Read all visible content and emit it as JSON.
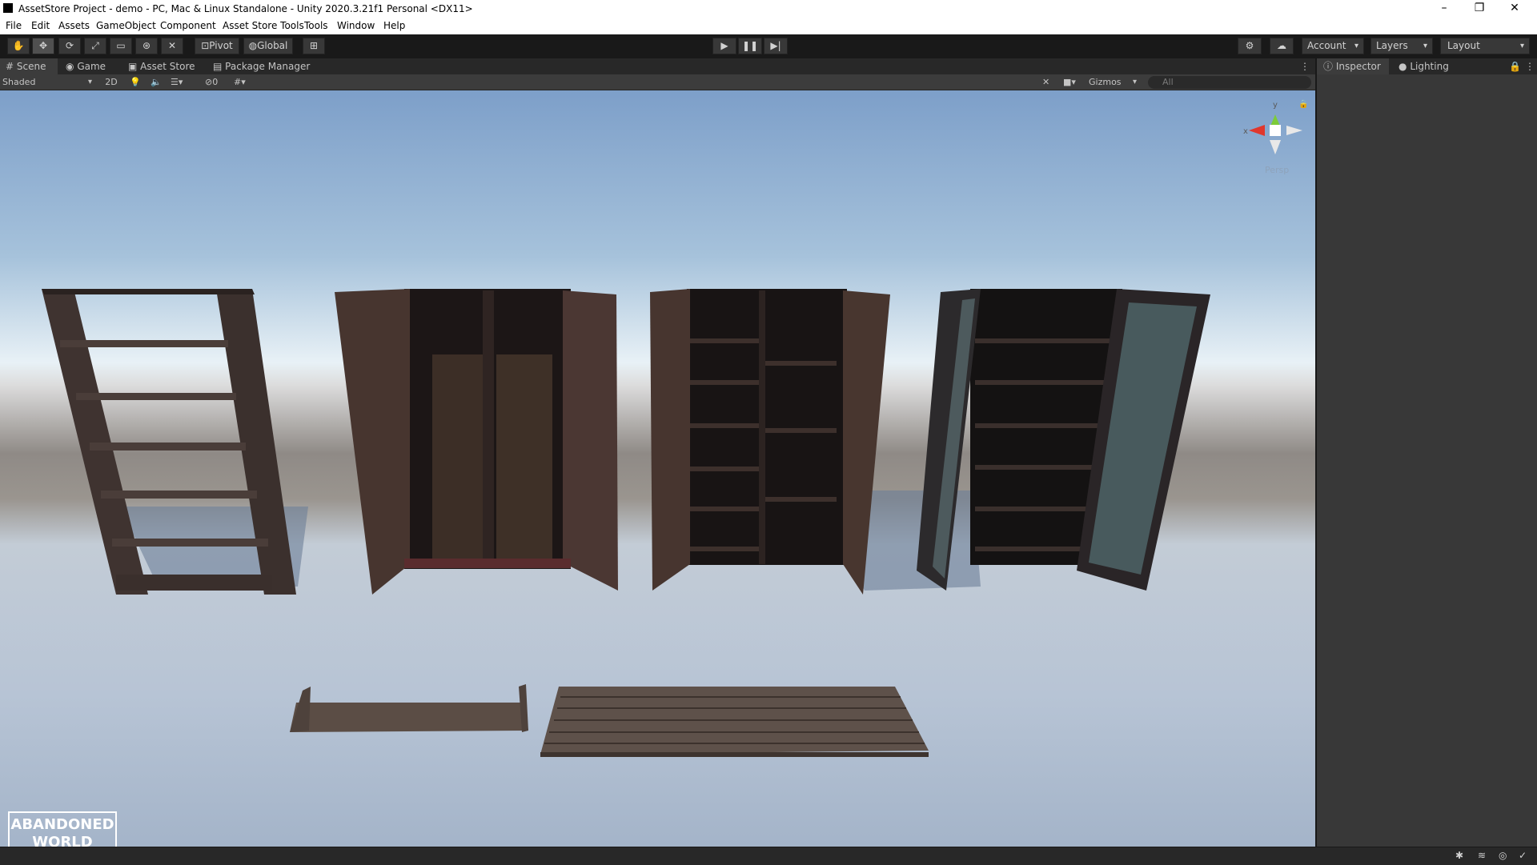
{
  "window": {
    "title": "AssetStore Project - demo - PC, Mac & Linux Standalone - Unity 2020.3.21f1 Personal <DX11>"
  },
  "menu": [
    "File",
    "Edit",
    "Assets",
    "GameObject",
    "Component",
    "Asset Store Tools",
    "Tools",
    "Window",
    "Help"
  ],
  "toolbar": {
    "pivot": "Pivot",
    "global": "Global",
    "account": "Account",
    "layers": "Layers",
    "layout": "Layout"
  },
  "tabs": {
    "scene": "Scene",
    "game": "Game",
    "asset_store": "Asset Store",
    "package_manager": "Package Manager"
  },
  "scene_toolbar": {
    "shading": "Shaded",
    "mode_2d": "2D",
    "hidden_count": "0",
    "gizmos": "Gizmos",
    "search_placeholder": "All"
  },
  "gizmo": {
    "y": "y",
    "x": "x",
    "persp": "Persp"
  },
  "right_tabs": {
    "inspector": "Inspector",
    "lighting": "Lighting"
  },
  "logo": {
    "line1": "ABANDONED",
    "line2": "WORLD"
  },
  "colors": {
    "editor_bg": "#191919",
    "panel": "#383838",
    "tab_bar": "#282828",
    "sky_top": "#7d9fc9",
    "ground": "#b7c4d5"
  }
}
